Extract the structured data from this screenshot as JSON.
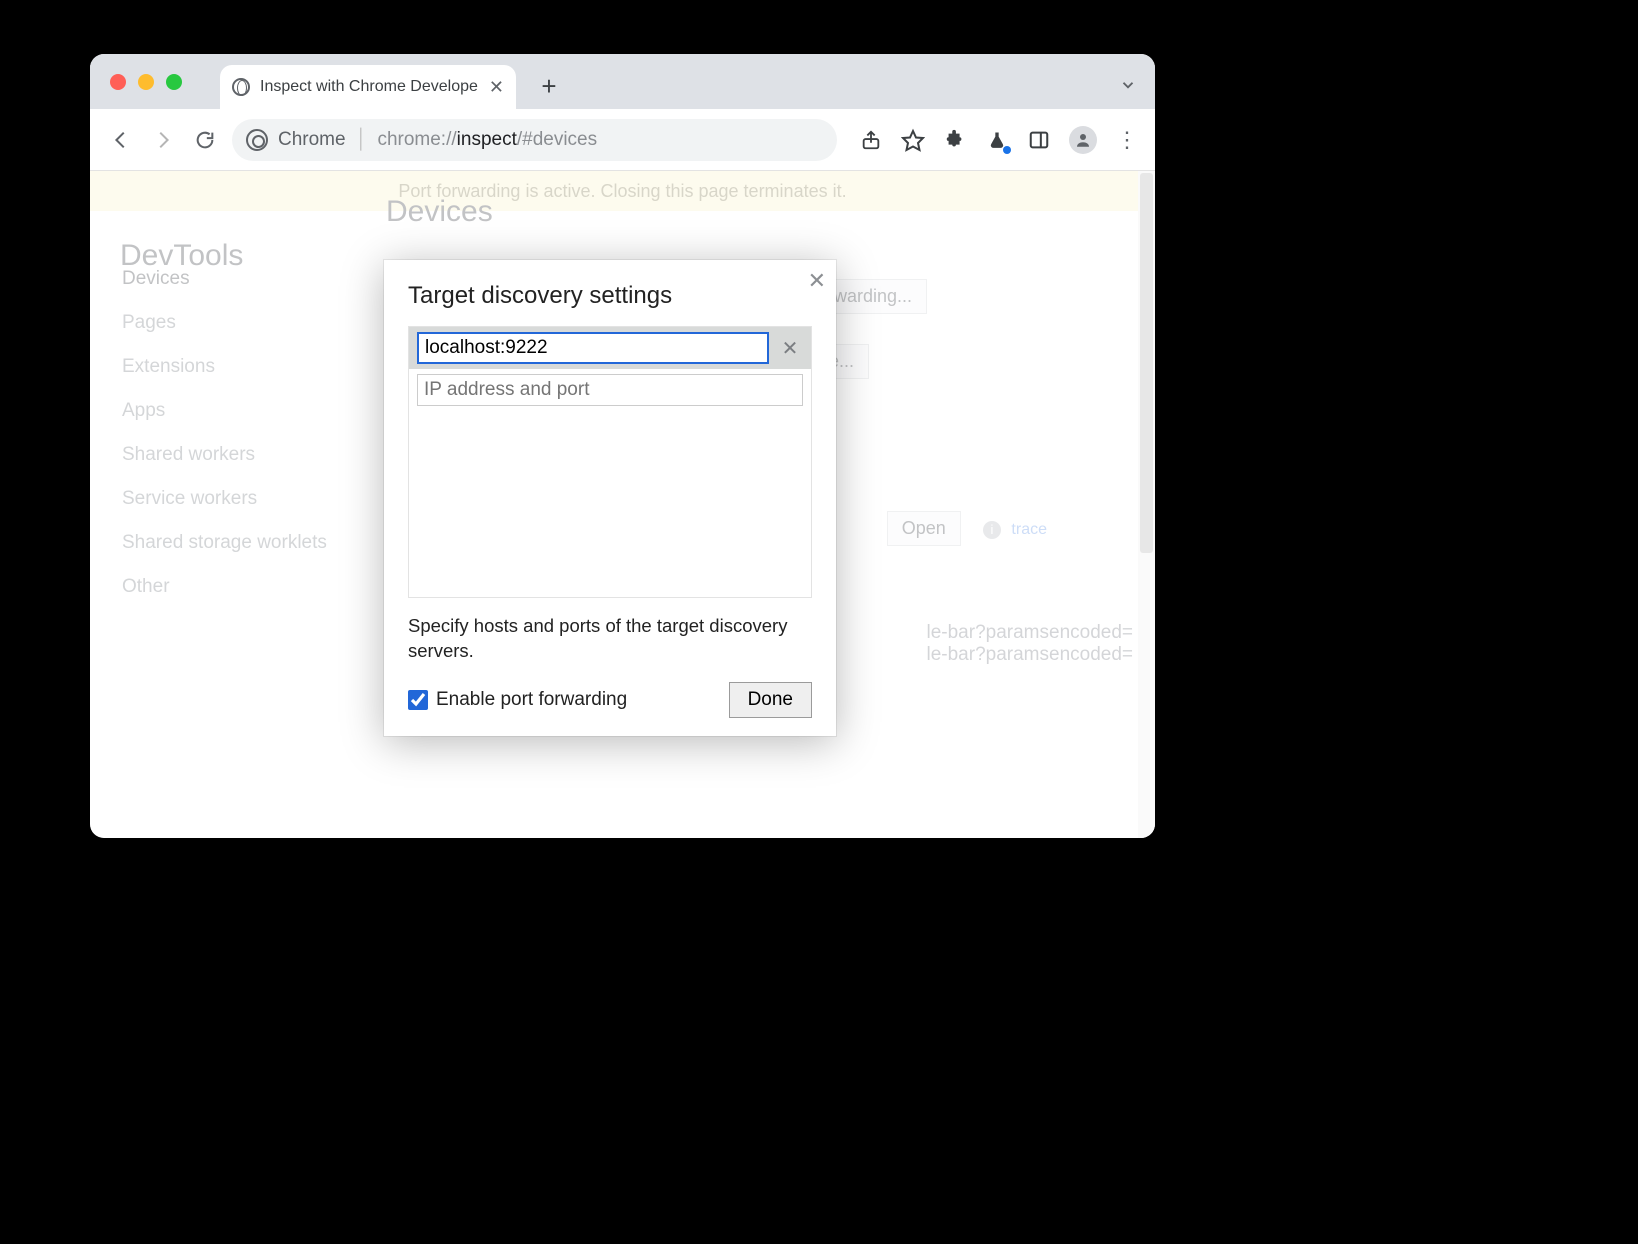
{
  "browser": {
    "tab_title": "Inspect with Chrome Develope",
    "new_tab_icon": "+",
    "tabs_chevron_icon": "⌄"
  },
  "toolbar": {
    "back_icon": "←",
    "forward_icon": "→",
    "reload_icon": "⟳",
    "address": {
      "prefix": "Chrome",
      "path_prefix": "chrome://",
      "path_bold": "inspect",
      "path_suffix": "/#devices"
    },
    "share_icon": "share",
    "star_icon": "☆",
    "extensions_icon": "✦",
    "flask_icon": "flask",
    "panel_icon": "▣",
    "profile_icon": "●",
    "menu_icon": "⋮"
  },
  "banner": "Port forwarding is active. Closing this page terminates it.",
  "sidebar": {
    "title": "DevTools",
    "items": [
      "Devices",
      "Pages",
      "Extensions",
      "Apps",
      "Shared workers",
      "Service workers",
      "Shared storage worklets",
      "Other"
    ],
    "active_index": 0
  },
  "main": {
    "heading": "Devices",
    "port_forwarding_btn": "rwarding...",
    "configure_btn": "ure...",
    "open_btn": "Open",
    "trace_link": "trace",
    "partial1": "le-bar?paramsencoded=",
    "partial2": "le-bar?paramsencoded="
  },
  "dialog": {
    "title": "Target discovery settings",
    "input_value": "localhost:9222",
    "placeholder": "IP address and port",
    "description": "Specify hosts and ports of the target discovery servers.",
    "checkbox_label": "Enable port forwarding",
    "checkbox_checked": true,
    "done_label": "Done"
  }
}
